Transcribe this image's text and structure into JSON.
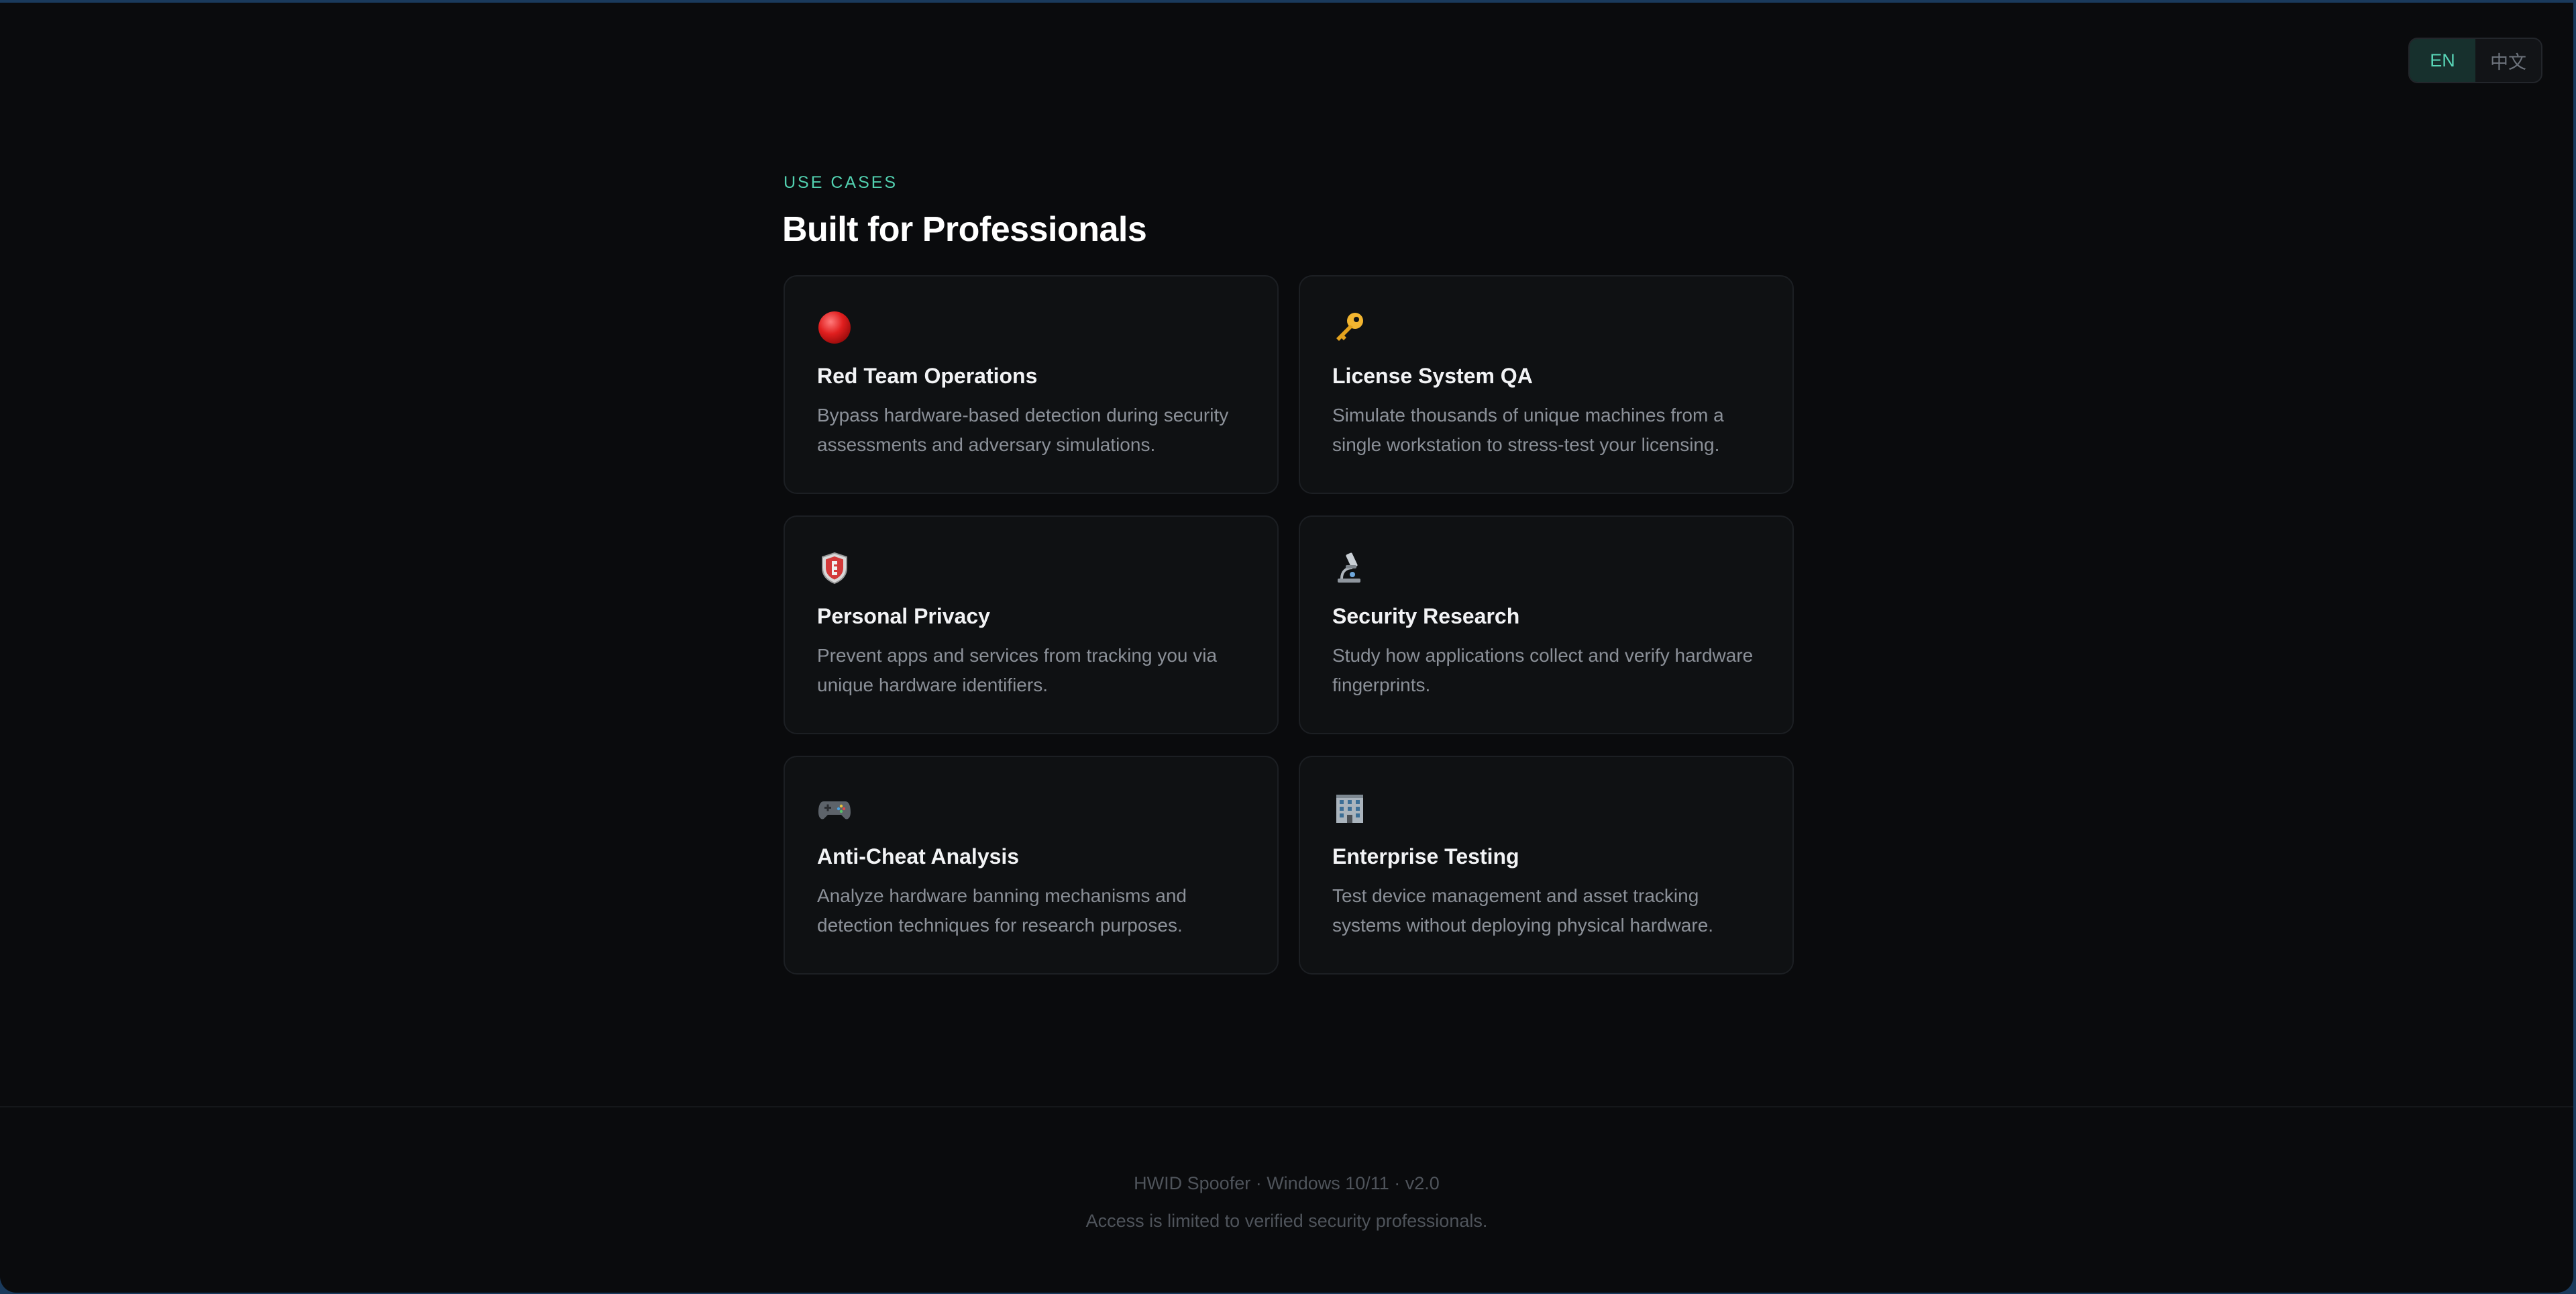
{
  "language_switch": {
    "options": [
      {
        "label": "EN",
        "active": true
      },
      {
        "label": "中文",
        "active": false
      }
    ]
  },
  "section": {
    "eyebrow": "USE CASES",
    "title": "Built for Professionals"
  },
  "cards": [
    {
      "icon": "red-circle-icon",
      "title": "Red Team Operations",
      "description": "Bypass hardware-based detection during security assessments and adversary simulations."
    },
    {
      "icon": "key-icon",
      "title": "License System QA",
      "description": "Simulate thousands of unique machines from a single workstation to stress-test your licensing."
    },
    {
      "icon": "shield-icon",
      "title": "Personal Privacy",
      "description": "Prevent apps and services from tracking you via unique hardware identifiers."
    },
    {
      "icon": "microscope-icon",
      "title": "Security Research",
      "description": "Study how applications collect and verify hardware fingerprints."
    },
    {
      "icon": "game-controller-icon",
      "title": "Anti-Cheat Analysis",
      "description": "Analyze hardware banning mechanisms and detection techniques for research purposes."
    },
    {
      "icon": "office-building-icon",
      "title": "Enterprise Testing",
      "description": "Test device management and asset tracking systems without deploying physical hardware."
    }
  ],
  "footer": {
    "product_line": "HWID Spoofer · Windows 10/11 · v2.0",
    "notice": "Access is limited to verified security professionals."
  },
  "colors": {
    "accent": "#52d1b0",
    "background": "#0a0b0d",
    "card_background": "#0f1113"
  }
}
